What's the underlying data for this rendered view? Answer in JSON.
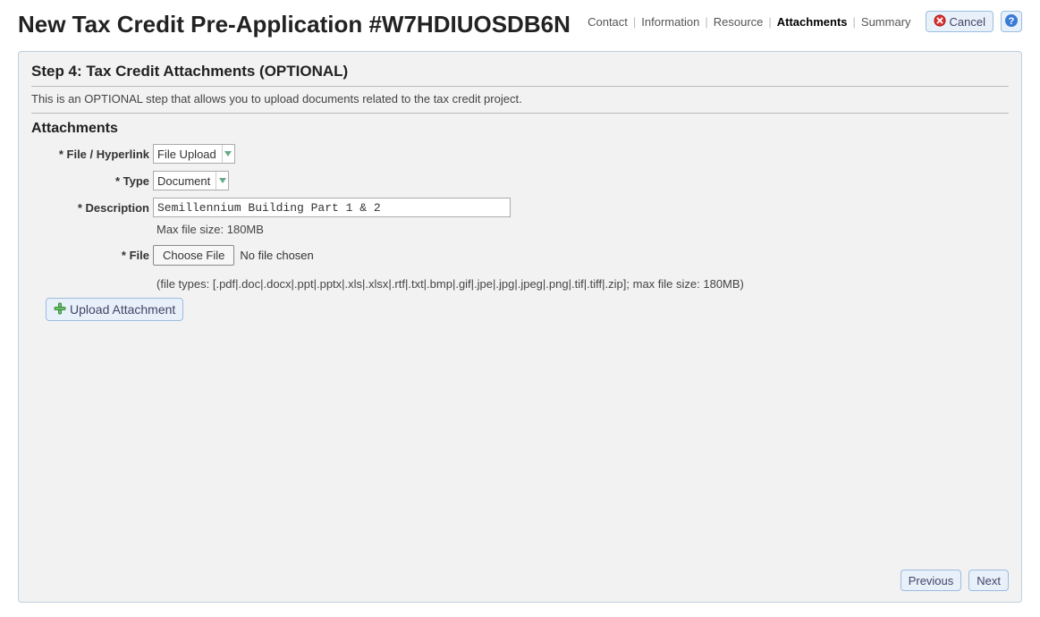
{
  "header": {
    "title": "New Tax Credit Pre-Application #W7HDIUOSDB6N",
    "steps": [
      "Contact",
      "Information",
      "Resource",
      "Attachments",
      "Summary"
    ],
    "active_step_index": 3,
    "cancel_label": "Cancel"
  },
  "step": {
    "heading": "Step 4: Tax Credit Attachments (OPTIONAL)",
    "description": "This is an OPTIONAL step that allows you to upload documents related to the tax credit project."
  },
  "attachments": {
    "section_label": "Attachments",
    "labels": {
      "file_hyperlink": "* File / Hyperlink",
      "type": "* Type",
      "description": "* Description",
      "file": "* File"
    },
    "values": {
      "file_hyperlink": "File Upload",
      "type": "Document",
      "description": "Semillennium Building Part 1 & 2"
    },
    "max_file_hint": "Max file size: 180MB",
    "choose_file_label": "Choose File",
    "file_status": "No file chosen",
    "filetypes_hint": "(file types: [.pdf|.doc|.docx|.ppt|.pptx|.xls|.xlsx|.rtf|.txt|.bmp|.gif|.jpe|.jpg|.jpeg|.png|.tif|.tiff|.zip]; max file size: 180MB)",
    "upload_button_label": "Upload Attachment"
  },
  "footer": {
    "previous": "Previous",
    "next": "Next"
  }
}
